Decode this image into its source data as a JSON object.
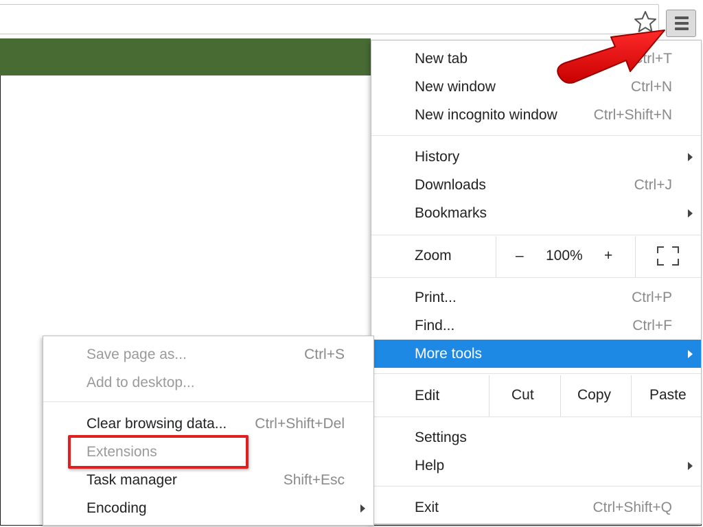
{
  "main_menu": {
    "group1": [
      {
        "label": "New tab",
        "shortcut": "Ctrl+T"
      },
      {
        "label": "New window",
        "shortcut": "Ctrl+N"
      },
      {
        "label": "New incognito window",
        "shortcut": "Ctrl+Shift+N"
      }
    ],
    "group2": [
      {
        "label": "History",
        "shortcut": ""
      },
      {
        "label": "Downloads",
        "shortcut": "Ctrl+J"
      },
      {
        "label": "Bookmarks",
        "shortcut": ""
      }
    ],
    "zoom": {
      "label": "Zoom",
      "minus": "–",
      "level": "100%",
      "plus": "+"
    },
    "group3": [
      {
        "label": "Print...",
        "shortcut": "Ctrl+P"
      },
      {
        "label": "Find...",
        "shortcut": "Ctrl+F"
      },
      {
        "label": "More tools",
        "shortcut": ""
      }
    ],
    "edit": {
      "label": "Edit",
      "cut": "Cut",
      "copy": "Copy",
      "paste": "Paste"
    },
    "group4": [
      {
        "label": "Settings",
        "shortcut": ""
      },
      {
        "label": "Help",
        "shortcut": ""
      }
    ],
    "exit": {
      "label": "Exit",
      "shortcut": "Ctrl+Shift+Q"
    }
  },
  "more_tools_menu": {
    "group1": [
      {
        "label": "Save page as...",
        "shortcut": "Ctrl+S"
      },
      {
        "label": "Add to desktop...",
        "shortcut": ""
      }
    ],
    "group2": [
      {
        "label": "Clear browsing data...",
        "shortcut": "Ctrl+Shift+Del"
      },
      {
        "label": "Extensions",
        "shortcut": ""
      },
      {
        "label": "Task manager",
        "shortcut": "Shift+Esc"
      },
      {
        "label": "Encoding",
        "shortcut": ""
      }
    ]
  },
  "colors": {
    "highlight": "#1e88e5",
    "page_banner": "#476b33",
    "annotation": "#e02020"
  },
  "icons": {
    "bookmark": "star-icon",
    "menu": "hamburger-menu-icon",
    "fullscreen": "fullscreen-icon",
    "submenu": "chevron-right-icon"
  }
}
